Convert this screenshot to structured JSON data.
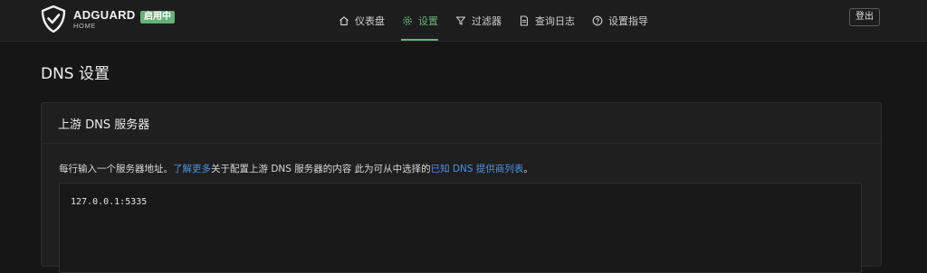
{
  "header": {
    "brand_name": "ADGUARD",
    "brand_sub": "HOME",
    "status_badge": "启用中",
    "logout_label": "登出"
  },
  "nav": {
    "items": [
      {
        "label": "仪表盘",
        "icon": "home-icon",
        "active": false
      },
      {
        "label": "设置",
        "icon": "gear-icon",
        "active": true
      },
      {
        "label": "过滤器",
        "icon": "filter-icon",
        "active": false
      },
      {
        "label": "查询日志",
        "icon": "log-icon",
        "active": false
      },
      {
        "label": "设置指导",
        "icon": "help-icon",
        "active": false
      }
    ]
  },
  "page": {
    "title": "DNS 设置"
  },
  "upstream": {
    "card_title": "上游 DNS 服务器",
    "desc_prefix": "每行输入一个服务器地址。",
    "learn_more_link": "了解更多",
    "desc_middle": "关于配置上游 DNS 服务器的内容 此为可从中选择的",
    "providers_link": "已知 DNS 提供商列表",
    "desc_suffix": "。",
    "servers_value": "127.0.0.1:5335"
  },
  "colors": {
    "accent": "#67b279",
    "link": "#4f8fdf",
    "background": "#161616"
  }
}
